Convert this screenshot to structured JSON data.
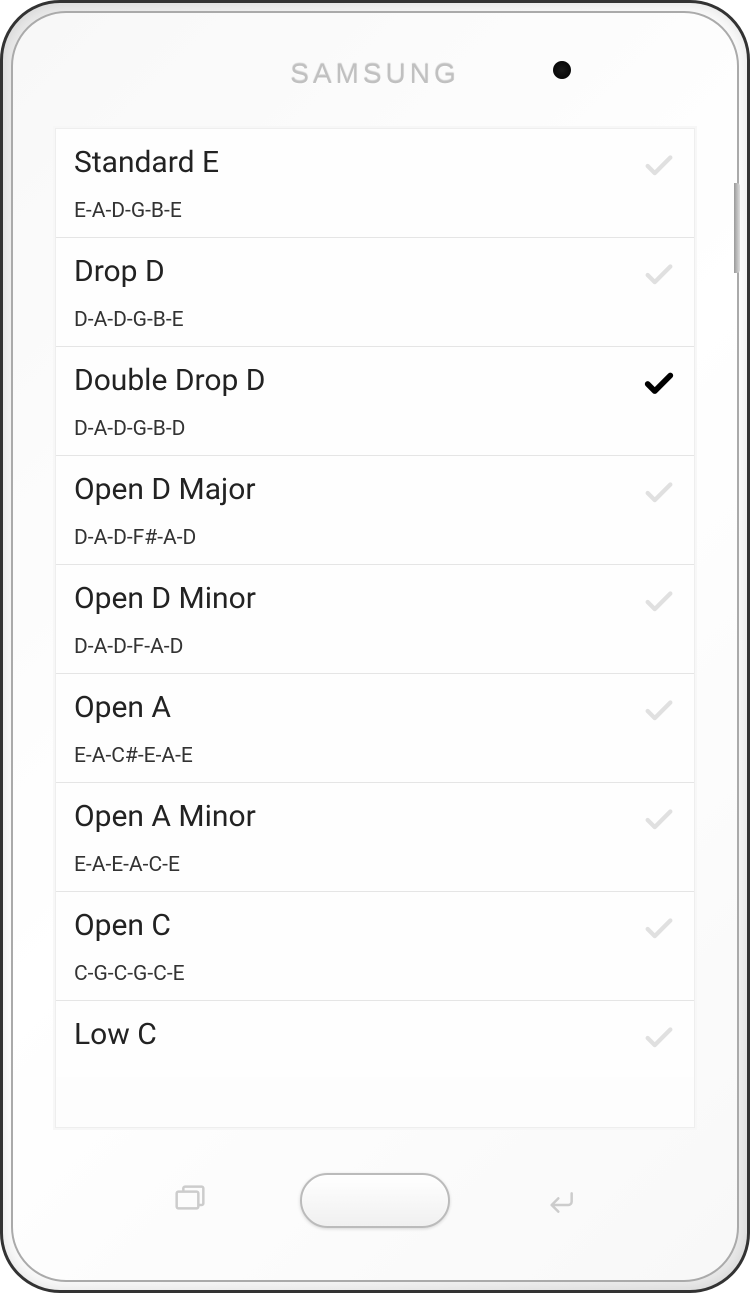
{
  "device": {
    "brand": "SAMSUNG"
  },
  "tunings": [
    {
      "name": "Standard E",
      "notes": "E-A-D-G-B-E",
      "selected": false
    },
    {
      "name": "Drop D",
      "notes": "D-A-D-G-B-E",
      "selected": false
    },
    {
      "name": "Double Drop D",
      "notes": "D-A-D-G-B-D",
      "selected": true
    },
    {
      "name": "Open D Major",
      "notes": "D-A-D-F#-A-D",
      "selected": false
    },
    {
      "name": "Open D Minor",
      "notes": "D-A-D-F-A-D",
      "selected": false
    },
    {
      "name": "Open A",
      "notes": "E-A-C#-E-A-E",
      "selected": false
    },
    {
      "name": "Open A Minor",
      "notes": "E-A-E-A-C-E",
      "selected": false
    },
    {
      "name": "Open C",
      "notes": "C-G-C-G-C-E",
      "selected": false
    },
    {
      "name": "Low C",
      "notes": "",
      "selected": false
    }
  ]
}
